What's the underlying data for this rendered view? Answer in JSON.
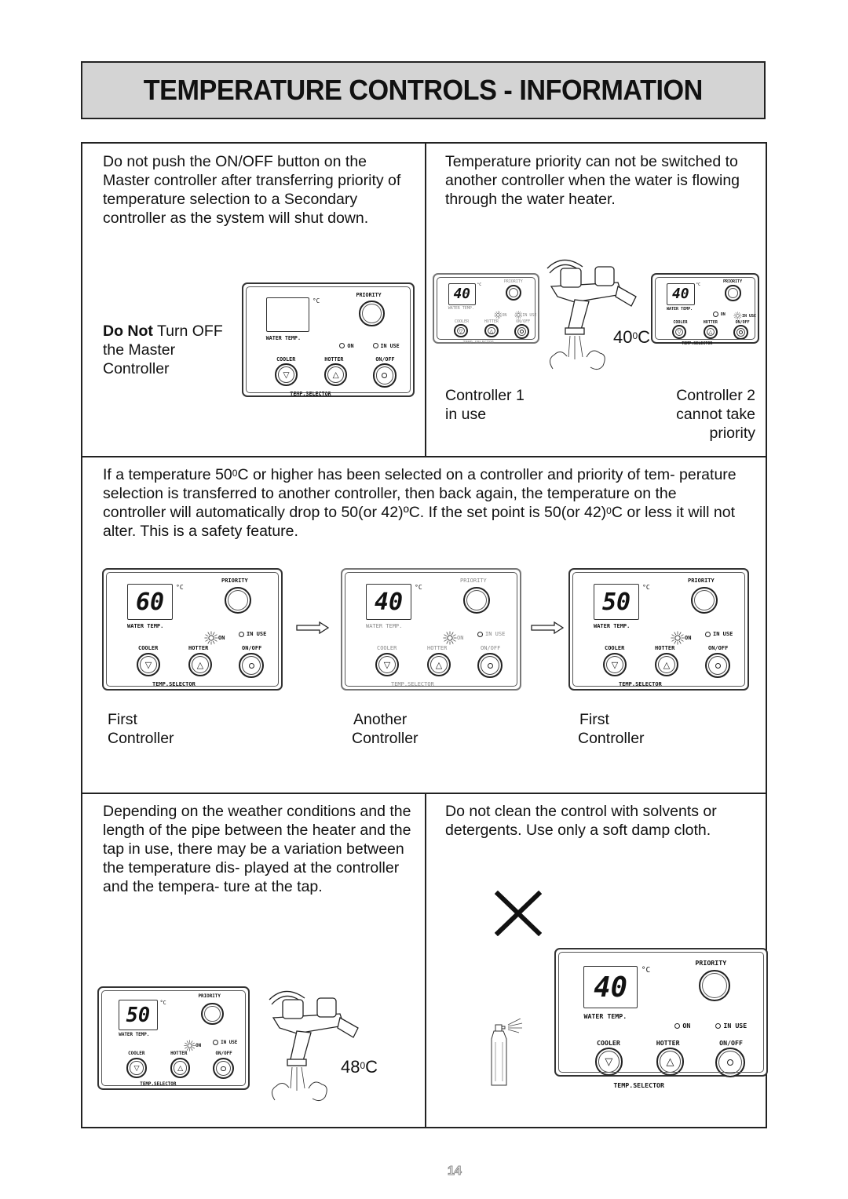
{
  "page": {
    "title": "TEMPERATURE CONTROLS - INFORMATION",
    "page_number": "14"
  },
  "section1": {
    "left_text": "Do not push the ON/OFF button on the Master controller after transferring priority of temperature selection to a Secondary controller as the system will shut down.",
    "left_caption_bold": "Do Not",
    "left_caption_rest": " Turn OFF the Master Controller",
    "right_text": "Temperature priority can not be switched to another controller when the water is flowing through the water heater.",
    "tap_temp_value": "40",
    "tap_temp_unit": "C",
    "controller1_caption": "Controller 1 in use",
    "controller2_caption": "Controller 2 cannot take priority"
  },
  "section2": {
    "text_a": "If a temperature 50",
    "text_b": "C or higher has been selected on a controller and priority of tem- perature selection is transferred to another controller, then back again, the temperature on the controller will automatically drop to 50(or 42)ºC. If the set point is 50(or 42)",
    "text_c": "C or less it will not alter.  This is a safety feature.",
    "sup": "0",
    "captions": [
      {
        "line1": "First",
        "line2": "Controller"
      },
      {
        "line1": "Another",
        "line2": "Controller"
      },
      {
        "line1": "First",
        "line2": "Controller"
      }
    ]
  },
  "section3": {
    "left_text": "Depending on the weather conditions and the length of the pipe between the heater and the tap in use, there may be a variation between the temperature dis- played at the controller and the tempera- ture at the tap.",
    "right_text": "Do not clean the  control with solvents or detergents. Use only a soft damp cloth.",
    "tap_temp_value": "48",
    "tap_temp_unit": "C"
  },
  "controller_labels": {
    "priority": "PRIORITY",
    "water_temp": "WATER TEMP.",
    "degc": "°C",
    "on": "ON",
    "in_use": "IN USE",
    "cooler": "COOLER",
    "hotter": "HOTTER",
    "onoff": "ON/OFF",
    "temp_selector": "TEMP.SELECTOR"
  },
  "controllers": {
    "master_off": {
      "display": ""
    },
    "ctrl1_inuse": {
      "display": "40"
    },
    "ctrl2_nopriority": {
      "display": "40"
    },
    "first_a": {
      "display": "60"
    },
    "another": {
      "display": "40"
    },
    "first_b": {
      "display": "50"
    },
    "weather": {
      "display": "50"
    },
    "cleaning": {
      "display": "40"
    }
  }
}
